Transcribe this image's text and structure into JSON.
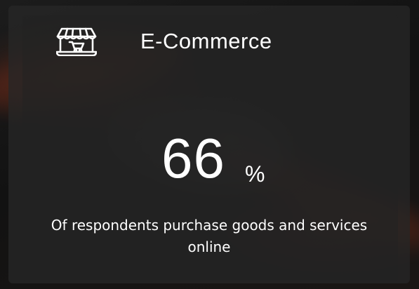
{
  "card": {
    "icon": "storefront-cart-icon",
    "title": "E-Commerce",
    "stat_value": "66",
    "stat_unit": "%",
    "description": "Of respondents purchase goods and services online"
  },
  "colors": {
    "text": "#ffffff",
    "card_background": "#262626",
    "accent_glow": "#8a2f17"
  }
}
